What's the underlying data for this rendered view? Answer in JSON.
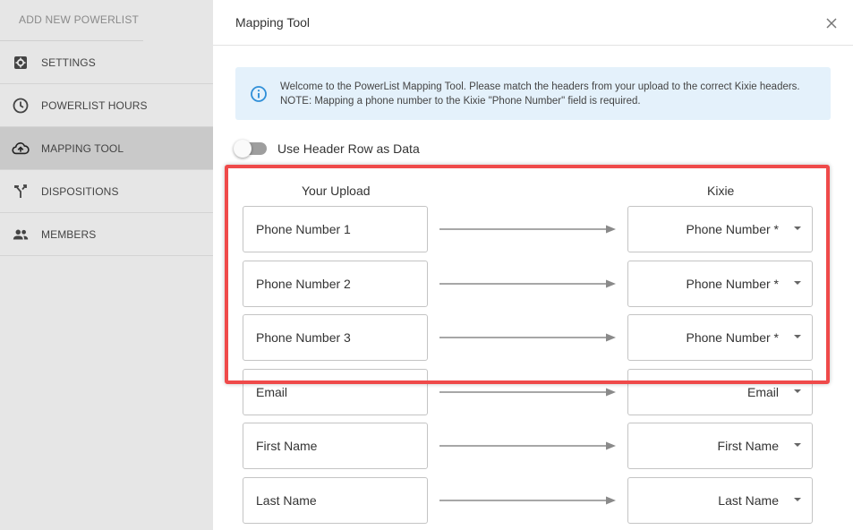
{
  "sidebar": {
    "top_label": "ADD NEW POWERLIST",
    "items": [
      {
        "label": "SETTINGS",
        "icon": "gear-icon"
      },
      {
        "label": "POWERLIST HOURS",
        "icon": "clock-icon"
      },
      {
        "label": "MAPPING TOOL",
        "icon": "cloud-upload-icon",
        "active": true
      },
      {
        "label": "DISPOSITIONS",
        "icon": "fork-icon"
      },
      {
        "label": "MEMBERS",
        "icon": "people-icon"
      }
    ]
  },
  "modal": {
    "title": "Mapping Tool",
    "info_text": "Welcome to the PowerList Mapping Tool. Please match the headers from your upload to the correct Kixie headers. NOTE: Mapping a phone number to the Kixie \"Phone Number\" field is required.",
    "toggle_label": "Use Header Row as Data",
    "toggle_on": false,
    "col_left": "Your Upload",
    "col_right": "Kixie",
    "rows": [
      {
        "upload": "Phone Number 1",
        "kixie": "Phone Number *"
      },
      {
        "upload": "Phone Number 2",
        "kixie": "Phone Number *"
      },
      {
        "upload": "Phone Number 3",
        "kixie": "Phone Number *"
      },
      {
        "upload": "Email",
        "kixie": "Email"
      },
      {
        "upload": "First Name",
        "kixie": "First Name"
      },
      {
        "upload": "Last Name",
        "kixie": "Last Name"
      }
    ]
  },
  "colors": {
    "highlight": "#ef4a4a",
    "info_bg": "#e4f1fb",
    "info_icon": "#2f8fd8",
    "sidebar_bg": "#e6e6e6",
    "sidebar_active": "#c9c9c9"
  }
}
